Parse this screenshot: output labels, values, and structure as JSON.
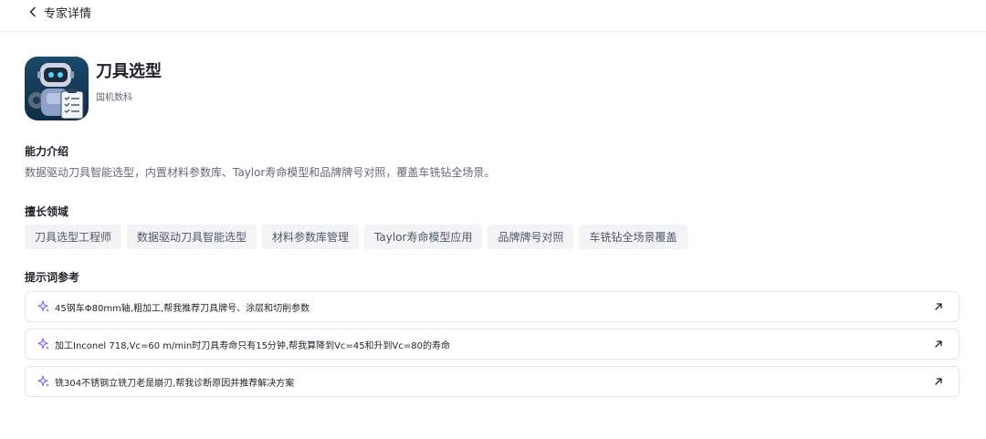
{
  "header": {
    "back_label": "专家详情"
  },
  "agent": {
    "name": "刀具选型",
    "org": "国机数科"
  },
  "intro": {
    "title": "能力介绍",
    "text": "数据驱动刀具智能选型，内置材料参数库、Taylor寿命模型和品牌牌号对照，覆盖车铣钻全场景。"
  },
  "domains": {
    "title": "擅长领域",
    "tags": [
      "刀具选型工程师",
      "数据驱动刀具智能选型",
      "材料参数库管理",
      "Taylor寿命模型应用",
      "品牌牌号对照",
      "车铣钻全场景覆盖"
    ]
  },
  "prompts": {
    "title": "提示词参考",
    "items": [
      "45钢车Φ80mm轴,粗加工,帮我推荐刀具牌号、涂层和切削参数",
      "加工Inconel 718,Vc=60 m/min时刀具寿命只有15分钟,帮我算降到Vc=45和升到Vc=80的寿命",
      "铣304不锈钢立铣刀老是崩刃,帮我诊断原因并推荐解决方案"
    ]
  },
  "colors": {
    "accent": "#8a5cf6",
    "text": "#1f2329",
    "muted": "#646a73"
  },
  "icons": {
    "back": "chevron-left-icon",
    "sparkle": "sparkle-icon",
    "arrow": "arrow-up-right-icon"
  }
}
